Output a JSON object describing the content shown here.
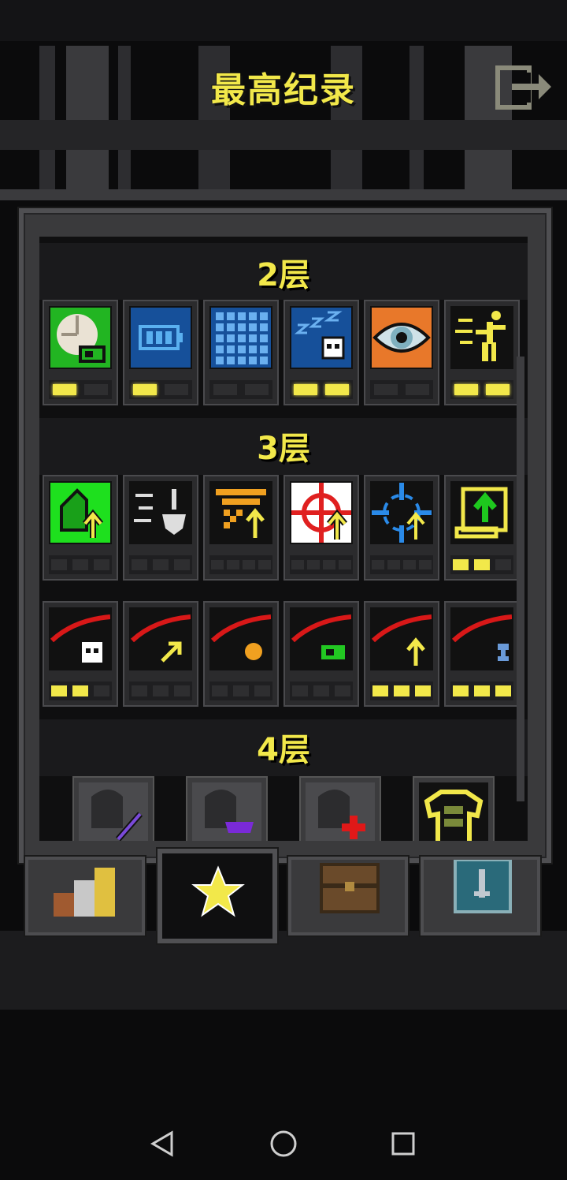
{
  "header": {
    "title": "最高纪录",
    "exit_icon": "exit-icon"
  },
  "sections": [
    {
      "label": "2层"
    },
    {
      "label": "3层"
    },
    {
      "label": "4层"
    }
  ],
  "tabs": [
    {
      "icon": "stats-icon",
      "active": false
    },
    {
      "icon": "star-icon",
      "active": true
    },
    {
      "icon": "chest-icon",
      "active": false
    },
    {
      "icon": "card-icon",
      "active": false
    }
  ],
  "nav": {
    "back": "back-icon",
    "home": "home-icon",
    "recent": "recent-icon"
  },
  "colors": {
    "accent": "#f2e84a",
    "panel": "#3a3a3c"
  }
}
